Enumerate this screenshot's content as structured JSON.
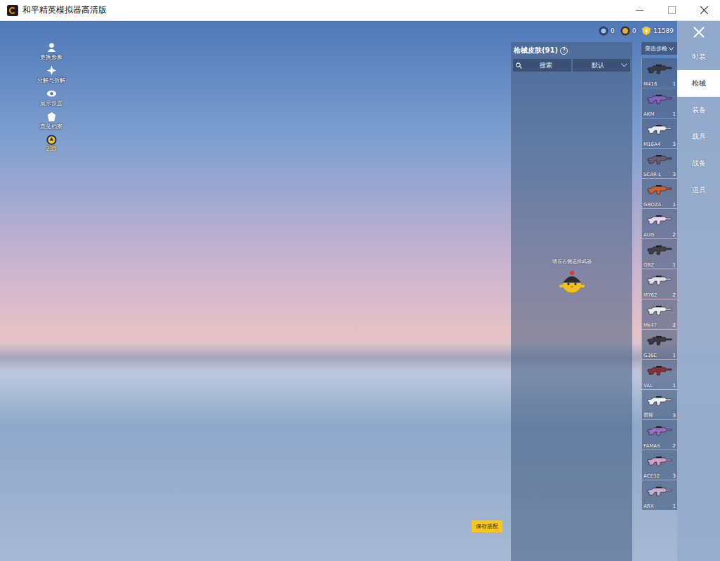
{
  "window": {
    "title": "和平精英模拟器高清版"
  },
  "left_menu": [
    {
      "label": "更换形象"
    },
    {
      "label": "分解与拆解"
    },
    {
      "label": "展示设置"
    },
    {
      "label": "意见档案"
    }
  ],
  "level": {
    "value": "235"
  },
  "currencies": [
    {
      "amount": "0"
    },
    {
      "amount": "0"
    },
    {
      "amount": "11589"
    }
  ],
  "skin_panel": {
    "title": "枪械皮肤(91)",
    "help": "?",
    "search": {
      "placeholder": "搜索"
    },
    "sort": "默认",
    "prompt": "请在右侧选择武器"
  },
  "weapon_list": {
    "category": "突击步枪",
    "items": [
      {
        "name": "M416",
        "count": "1",
        "selected": false,
        "color": "#3a3a46"
      },
      {
        "name": "AKM",
        "count": "1",
        "selected": false,
        "color": "#8a5fc0"
      },
      {
        "name": "M16A4",
        "count": "3",
        "selected": false,
        "color": "#ececf4"
      },
      {
        "name": "SCAR-L",
        "count": "3",
        "selected": false,
        "color": "#6a5a70"
      },
      {
        "name": "GROZA",
        "count": "1",
        "selected": false,
        "color": "#d0602a"
      },
      {
        "name": "AUG",
        "count": "2",
        "selected": false,
        "color": "#ead8ee"
      },
      {
        "name": "QBZ",
        "count": "1",
        "selected": false,
        "color": "#404044"
      },
      {
        "name": "M762",
        "count": "2",
        "selected": false,
        "color": "#e2e2ea"
      },
      {
        "name": "Mk47",
        "count": "2",
        "selected": false,
        "color": "#f0f0f0"
      },
      {
        "name": "G36C",
        "count": "1",
        "selected": false,
        "color": "#38383c"
      },
      {
        "name": "VAL",
        "count": "1",
        "selected": false,
        "color": "#8a3030"
      },
      {
        "name": "蜜獾",
        "count": "3",
        "selected": false,
        "color": "#f2f2f6"
      },
      {
        "name": "FAMAS",
        "count": "2",
        "selected": false,
        "color": "#9a70c8"
      },
      {
        "name": "ACE32",
        "count": "3",
        "selected": false,
        "color": "#d8a0c8"
      },
      {
        "name": "ARX",
        "count": "1",
        "selected": false,
        "color": "#c8b0d0"
      }
    ]
  },
  "nav_tabs": [
    {
      "label": "时装",
      "selected": false
    },
    {
      "label": "枪械",
      "selected": true
    },
    {
      "label": "装备",
      "selected": false
    },
    {
      "label": "载具",
      "selected": false
    },
    {
      "label": "战备",
      "selected": false
    },
    {
      "label": "道具",
      "selected": false
    }
  ],
  "save_button": {
    "label": "保存搭配"
  }
}
